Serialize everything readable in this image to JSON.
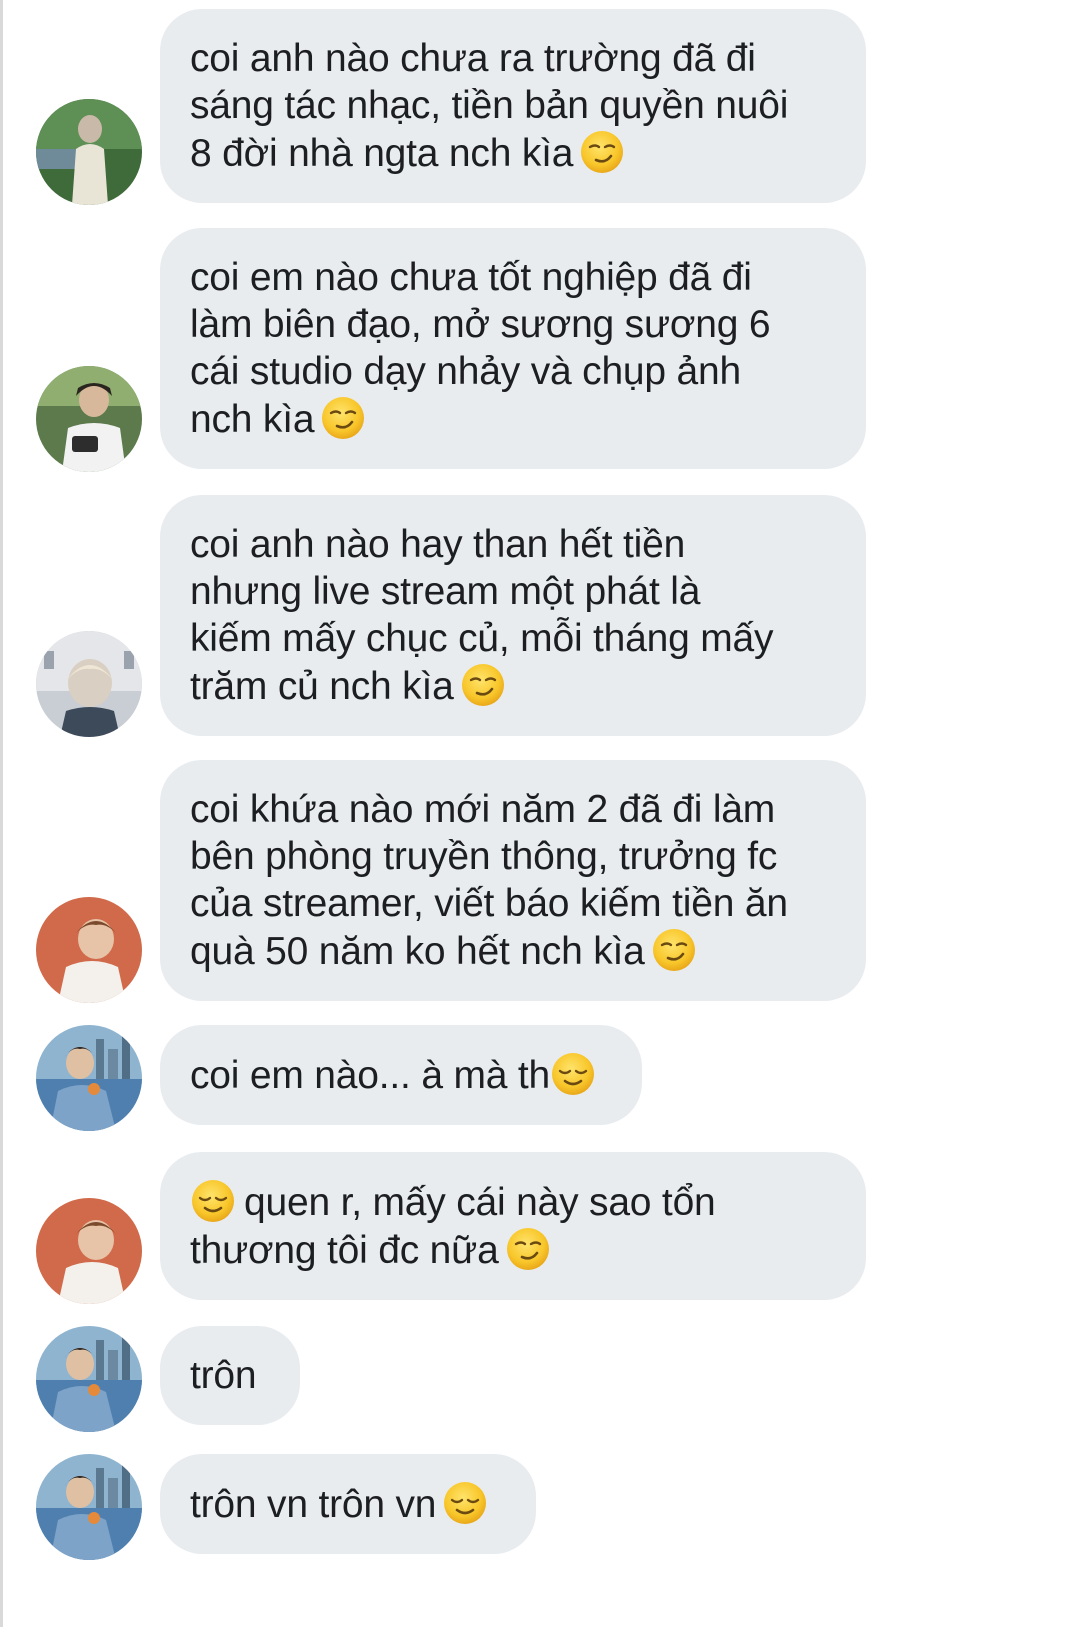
{
  "conversation": {
    "messages": [
      {
        "lines": [
          "coi anh nào chưa ra trường đã đi",
          "sáng tác nhạc, tiền bản quyền nuôi",
          "8 đời nhà ngta nch kìa"
        ],
        "trailing_emoji": "smirk-emoji",
        "avatar": "avatar-outdoor-jacket"
      },
      {
        "lines": [
          "coi em nào chưa tốt nghiệp đã đi",
          "làm biên đạo, mở sương sương 6",
          "cái studio dạy nhảy và chụp ảnh",
          "nch kìa"
        ],
        "trailing_emoji": "smirk-emoji",
        "avatar": "avatar-camera"
      },
      {
        "lines": [
          "coi anh nào hay than hết tiền",
          "nhưng live stream một phát là",
          "kiếm mấy chục củ, mỗi tháng mấy",
          "trăm củ nch kìa"
        ],
        "trailing_emoji": "smirk-emoji",
        "avatar": "avatar-blonde-building"
      },
      {
        "lines": [
          "coi khứa nào mới năm 2 đã đi làm",
          "bên phòng truyền thông, trưởng fc",
          "của streamer, viết báo kiếm tiền ăn",
          "quà 50 năm ko hết nch kìa"
        ],
        "trailing_emoji": "smirk-emoji",
        "avatar": "avatar-orange-bg"
      },
      {
        "lines": [
          "coi em nào... à mà th"
        ],
        "trailing_emoji": "relieved-emoji",
        "avatar": "avatar-denim-city"
      },
      {
        "lines": [
          "quen r, mấy cái này sao tổn",
          "thương tôi đc nữa"
        ],
        "leading_emoji": "relieved-emoji",
        "trailing_emoji": "smirk-emoji",
        "avatar": "avatar-orange-bg"
      },
      {
        "lines": [
          "trôn"
        ],
        "avatar": "avatar-denim-city"
      },
      {
        "lines": [
          "trôn vn trôn vn"
        ],
        "trailing_emoji": "relieved-emoji",
        "avatar": "avatar-denim-city"
      }
    ]
  },
  "colors": {
    "bubble": "#e9ecef",
    "text": "#1c1e21",
    "emoji_face": "#f7c52b"
  }
}
